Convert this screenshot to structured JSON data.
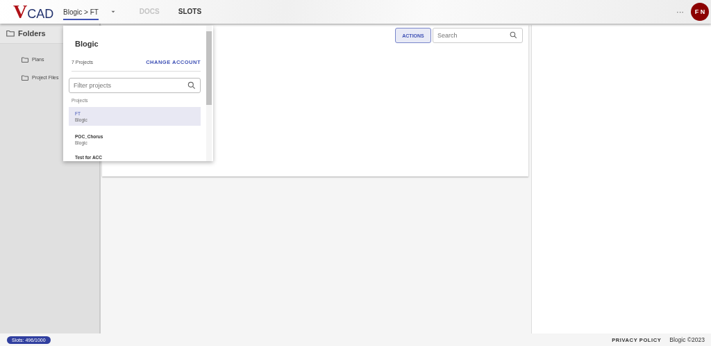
{
  "header": {
    "logo": {
      "mark": "V",
      "text": "CAD"
    },
    "tabs": [
      {
        "label": "Blogic > FT",
        "selected": true,
        "disabled": false,
        "kind": "dropdown"
      },
      {
        "label": "DOCS",
        "selected": false,
        "disabled": true,
        "kind": "plain"
      },
      {
        "label": "SLOTS",
        "selected": false,
        "disabled": false,
        "kind": "plain"
      }
    ],
    "more": "···",
    "avatar": "F N"
  },
  "sidebar": {
    "title": "Folders",
    "items": [
      {
        "label": "Plans"
      },
      {
        "label": "Project Files"
      }
    ]
  },
  "toolbar": {
    "actions": "ACTIONS",
    "search": {
      "placeholder": "Search"
    }
  },
  "account_menu": {
    "account": "Blogic",
    "count": "7 Projects",
    "change": "CHANGE ACCOUNT",
    "filter": {
      "placeholder": "Filter projects"
    },
    "section": "Projects",
    "projects": [
      {
        "name": "FT",
        "account": "Blogic",
        "selected": true
      },
      {
        "name": "POC_Chorus",
        "account": "Blogic",
        "selected": false
      },
      {
        "name": "Test for ACC",
        "selected": false
      }
    ]
  },
  "footer": {
    "slots": "Slots: 496/1000",
    "privacy": "PRIVACY POLICY",
    "copyright": "Blogic ©2023"
  }
}
